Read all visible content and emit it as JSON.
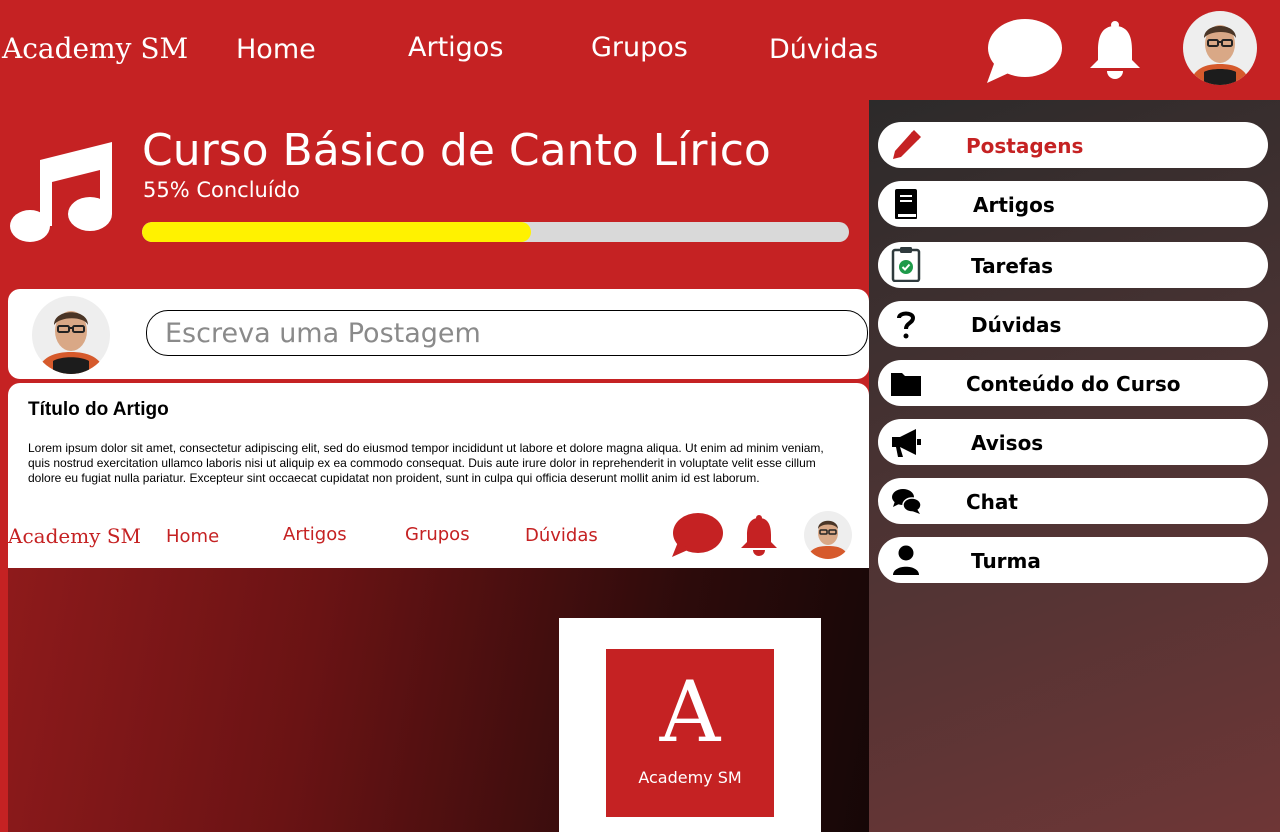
{
  "nav": {
    "brand": "Academy SM",
    "links": [
      "Home",
      "Artigos",
      "Grupos",
      "Dúvidas"
    ],
    "icons": [
      "chat-bubble-icon",
      "bell-icon",
      "user-avatar"
    ]
  },
  "course": {
    "title": "Curso Básico de Canto Lírico",
    "progress_label": "55% Concluído",
    "progress": 0.55,
    "icon": "music-note-icon"
  },
  "composer": {
    "placeholder": "Escreva uma Postagem"
  },
  "article": {
    "title": "Título do Artigo",
    "body": "Lorem ipsum dolor sit amet, consectetur adipiscing elit, sed do eiusmod tempor incididunt ut labore et dolore magna aliqua. Ut enim ad minim veniam, quis nostrud exercitation ullamco laboris nisi ut aliquip ex ea commodo consequat. Duis aute irure dolor in reprehenderit in voluptate velit esse cillum dolore eu fugiat nulla pariatur. Excepteur sint occaecat cupidatat non proident, sunt in culpa qui officia deserunt mollit anim id est laborum.",
    "preview": {
      "brand": "Academy SM",
      "links": [
        "Home",
        "Artigos",
        "Grupos",
        "Dúvidas"
      ],
      "logo_letter": "A",
      "logo_caption": "Academy SM"
    }
  },
  "sidebar": {
    "items": [
      {
        "label": "Postagens",
        "icon": "pencil-icon",
        "active": true
      },
      {
        "label": "Artigos",
        "icon": "book-icon"
      },
      {
        "label": "Tarefas",
        "icon": "clipboard-check-icon"
      },
      {
        "label": "Dúvidas",
        "icon": "question-icon"
      },
      {
        "label": "Conteúdo do Curso",
        "icon": "folder-icon"
      },
      {
        "label": "Avisos",
        "icon": "megaphone-icon"
      },
      {
        "label": "Chat",
        "icon": "chat-icon"
      },
      {
        "label": "Turma",
        "icon": "user-icon"
      }
    ]
  },
  "colors": {
    "brand_red": "#c52223",
    "progress_fill": "#fff200",
    "progress_track": "#d9d9d9"
  }
}
